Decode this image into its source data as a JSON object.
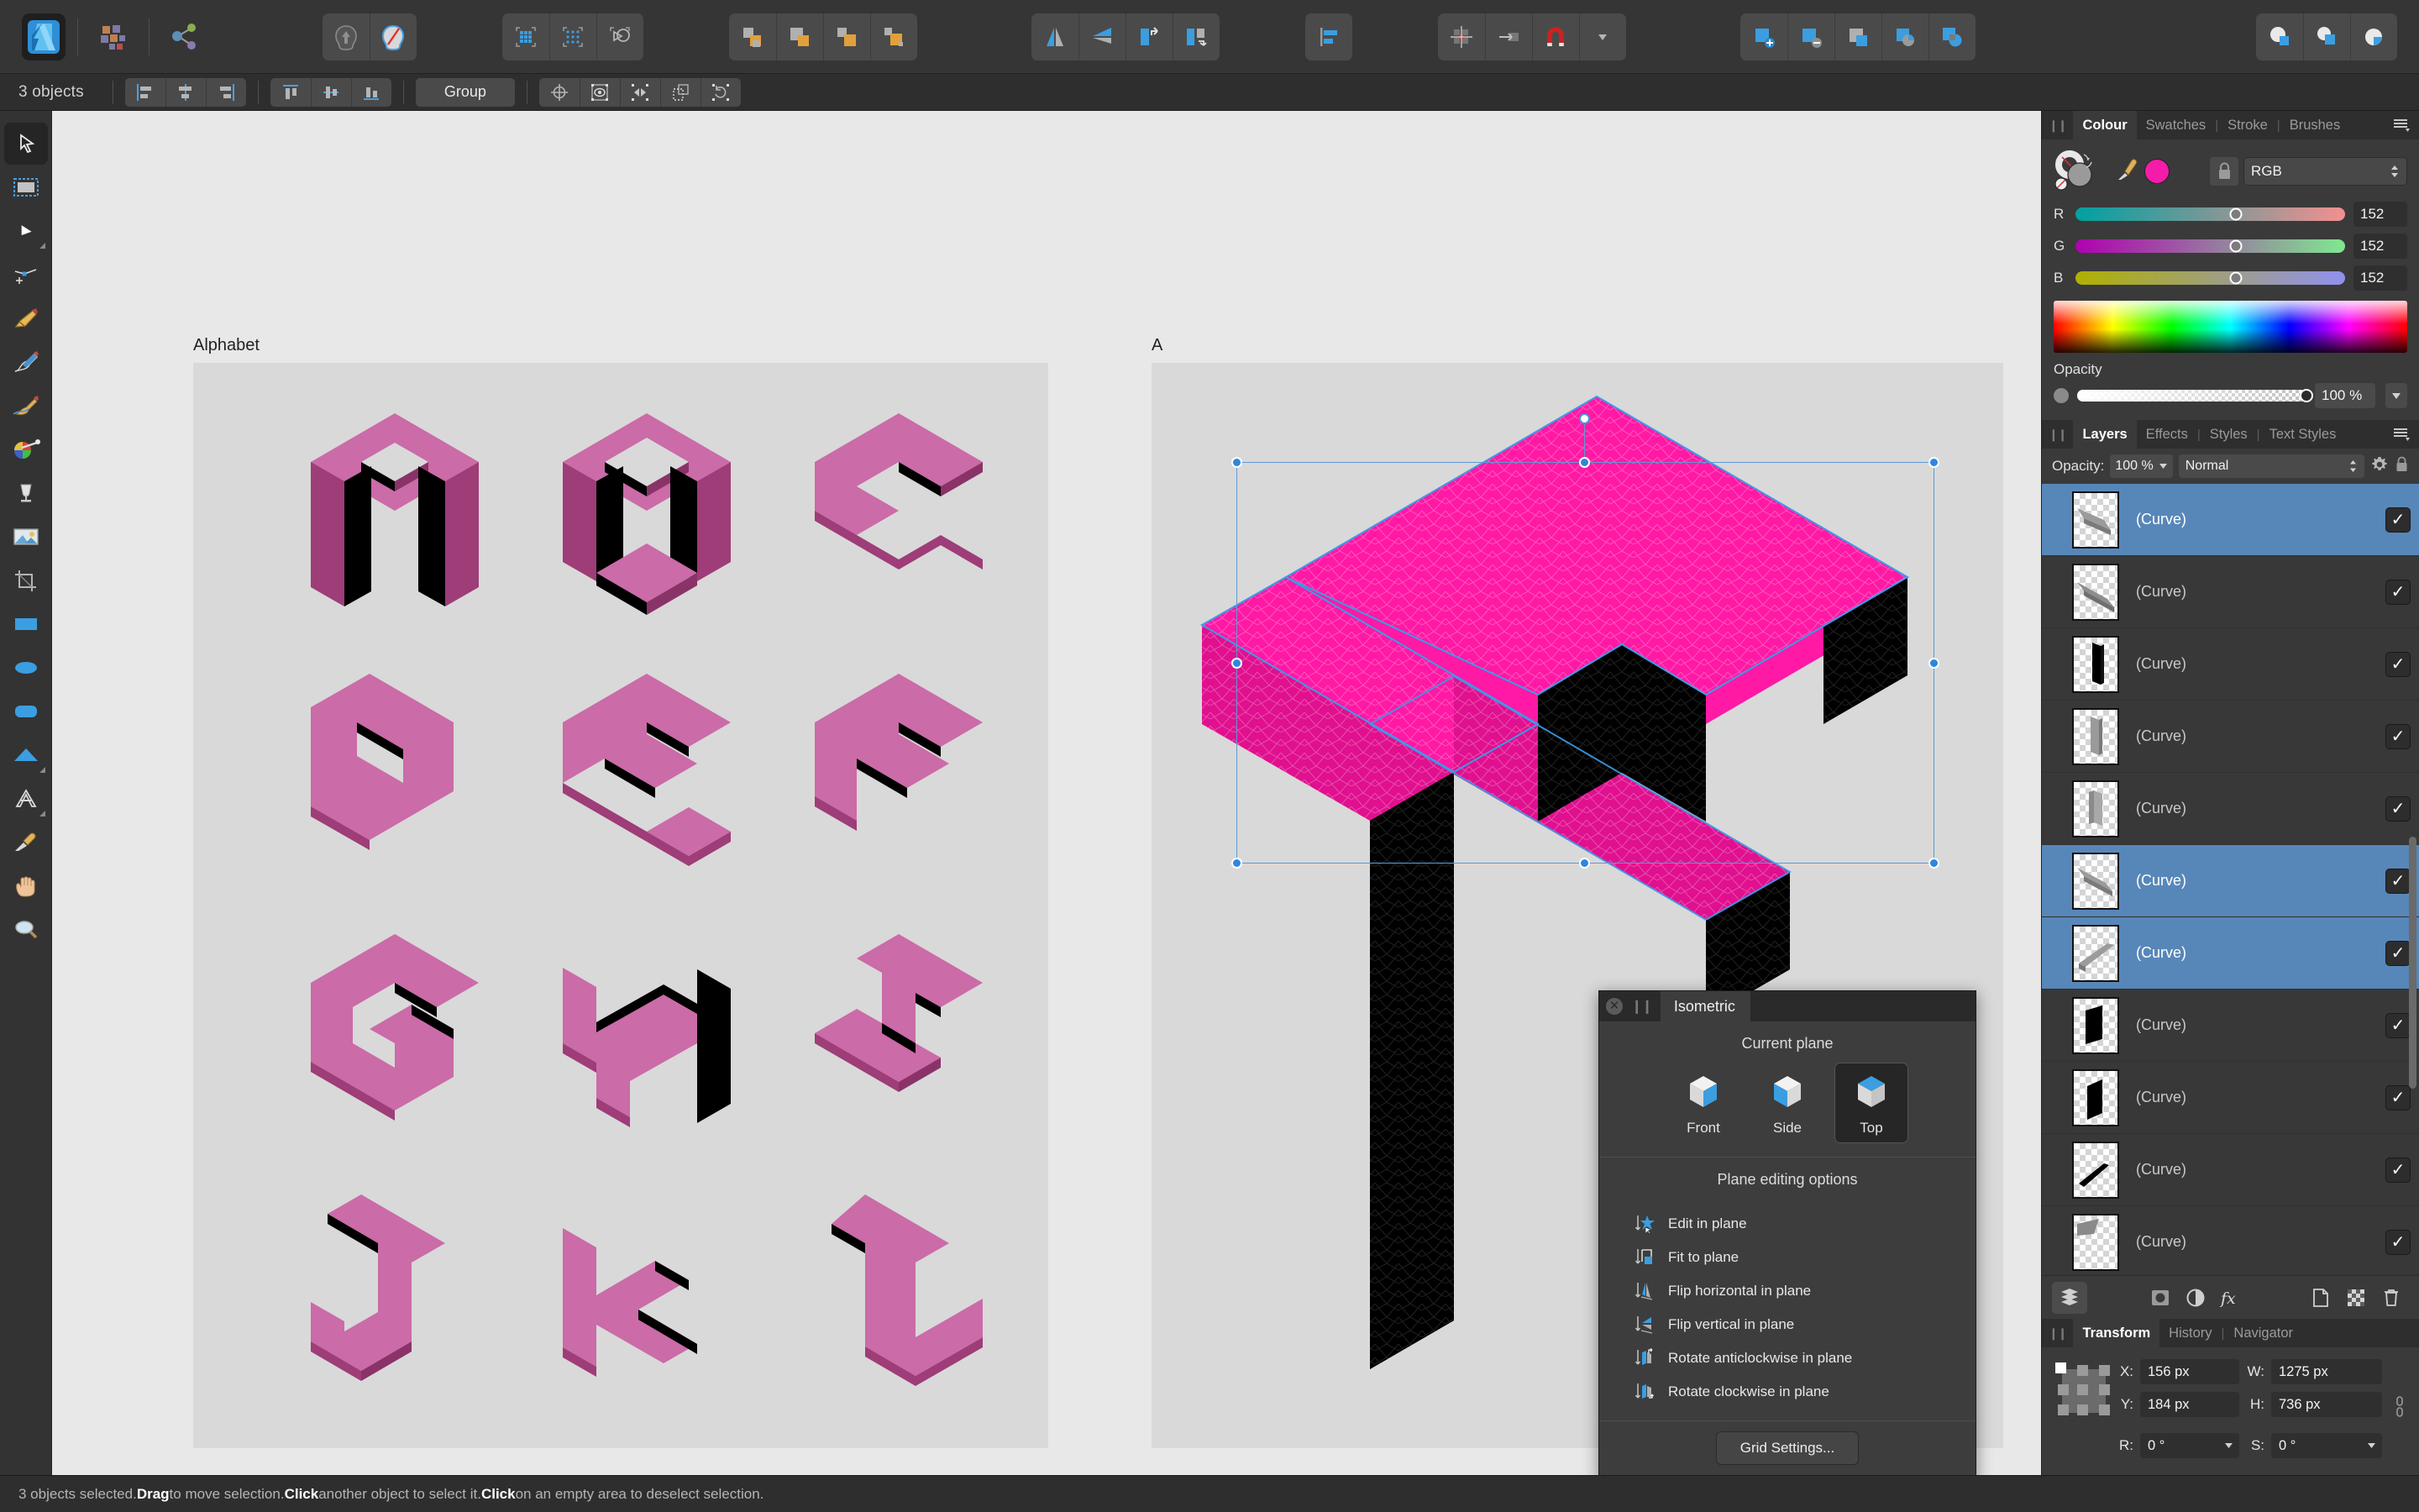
{
  "app": {
    "name": "Affinity Designer",
    "logo_icon": "affinity-designer-logo"
  },
  "toolbar": {
    "groups": [
      {
        "name": "assets",
        "buttons": [
          {
            "name": "assets-panel-button",
            "icon": "assets-grid-icon"
          },
          {
            "name": "share-button",
            "icon": "share-nodes-icon"
          }
        ]
      },
      {
        "name": "node-ops",
        "buttons": [
          {
            "name": "expand-stroke-button",
            "icon": "expand-stroke-icon"
          },
          {
            "name": "break-curve-button",
            "icon": "break-curve-icon"
          }
        ]
      },
      {
        "name": "grid-ops",
        "buttons": [
          {
            "name": "show-grid-button",
            "icon": "grid-icon"
          },
          {
            "name": "snap-to-grid-button",
            "icon": "dotted-grid-icon"
          },
          {
            "name": "geometry-button",
            "icon": "geometry-shapes-icon"
          }
        ]
      },
      {
        "name": "boolean-ops",
        "buttons": [
          {
            "name": "add-button",
            "icon": "boolean-add-icon"
          },
          {
            "name": "subtract-button",
            "icon": "boolean-subtract-icon"
          },
          {
            "name": "intersect-button",
            "icon": "boolean-intersect-icon"
          },
          {
            "name": "divide-button",
            "icon": "boolean-divide-icon"
          }
        ]
      },
      {
        "name": "flip-ops",
        "buttons": [
          {
            "name": "flip-horizontal-button",
            "icon": "flip-horizontal-icon"
          },
          {
            "name": "flip-vertical-button",
            "icon": "flip-vertical-icon"
          },
          {
            "name": "rotate-left-button",
            "icon": "rotate-left-icon"
          },
          {
            "name": "rotate-right-button",
            "icon": "rotate-right-icon"
          }
        ]
      },
      {
        "name": "align",
        "buttons": [
          {
            "name": "alignment-button",
            "icon": "align-left-icon"
          }
        ]
      },
      {
        "name": "snapping",
        "buttons": [
          {
            "name": "snapping-candidates-button",
            "icon": "snap-points-icon"
          },
          {
            "name": "snapping-move-button",
            "icon": "snap-move-icon",
            "active": true
          },
          {
            "name": "snapping-magnet-button",
            "icon": "magnet-icon",
            "has_dropdown": true
          }
        ]
      },
      {
        "name": "layer-ops",
        "buttons": [
          {
            "name": "add-layer-button",
            "icon": "layer-add-icon"
          },
          {
            "name": "remove-layer-button",
            "icon": "layer-remove-icon"
          },
          {
            "name": "mask-layer-button",
            "icon": "layer-mask-icon"
          },
          {
            "name": "clip-layer-button",
            "icon": "layer-clip-icon"
          },
          {
            "name": "merge-layer-button",
            "icon": "layer-merge-icon"
          }
        ]
      },
      {
        "name": "compound",
        "buttons": [
          {
            "name": "compound-add-button",
            "icon": "compound-add-icon"
          },
          {
            "name": "compound-subtract-button",
            "icon": "compound-subtract-icon"
          },
          {
            "name": "compound-xor-button",
            "icon": "compound-xor-icon"
          }
        ]
      }
    ]
  },
  "context_bar": {
    "selection_count": "3 objects",
    "align_h": [
      {
        "name": "align-left-button",
        "icon": "align-left-icon"
      },
      {
        "name": "align-center-horizontal-button",
        "icon": "align-center-h-icon"
      },
      {
        "name": "align-right-button",
        "icon": "align-right-icon"
      }
    ],
    "align_v": [
      {
        "name": "align-top-button",
        "icon": "align-top-icon"
      },
      {
        "name": "align-middle-button",
        "icon": "align-middle-icon"
      },
      {
        "name": "align-bottom-button",
        "icon": "align-bottom-icon"
      }
    ],
    "group_label": "Group",
    "extras": [
      {
        "name": "transform-origin-button",
        "icon": "crosshair-target-icon"
      },
      {
        "name": "show-handles-button",
        "icon": "eye-target-icon"
      },
      {
        "name": "mirror-button",
        "icon": "mirror-nodes-icon"
      },
      {
        "name": "duplicate-button",
        "icon": "duplicate-icon"
      },
      {
        "name": "reset-transform-button",
        "icon": "refresh-rotate-icon"
      }
    ]
  },
  "tools": [
    {
      "name": "move-tool",
      "icon": "arrow-cursor-icon",
      "active": true
    },
    {
      "name": "artboard-tool",
      "icon": "artboard-icon"
    },
    {
      "name": "node-tool",
      "icon": "node-cursor-icon",
      "flyout": true
    },
    {
      "name": "corner-tool",
      "icon": "corner-node-icon"
    },
    {
      "name": "pen-tool",
      "icon": "pen-nib-icon"
    },
    {
      "name": "pencil-tool",
      "icon": "pencil-icon"
    },
    {
      "name": "vector-brush-tool",
      "icon": "paint-brush-icon"
    },
    {
      "name": "fill-tool",
      "icon": "colour-wheel-icon"
    },
    {
      "name": "transparency-tool",
      "icon": "goblet-icon"
    },
    {
      "name": "place-image-tool",
      "icon": "image-icon"
    },
    {
      "name": "crop-tool",
      "icon": "crop-icon"
    },
    {
      "name": "rectangle-tool",
      "icon": "rectangle-icon"
    },
    {
      "name": "ellipse-tool",
      "icon": "ellipse-icon"
    },
    {
      "name": "rounded-rectangle-tool",
      "icon": "rounded-rect-icon"
    },
    {
      "name": "triangle-tool",
      "icon": "triangle-icon",
      "flyout": true
    },
    {
      "name": "artistic-text-tool",
      "icon": "text-a-icon",
      "flyout": true
    },
    {
      "name": "colour-picker-tool",
      "icon": "eyedropper-icon"
    },
    {
      "name": "view-tool",
      "icon": "hand-icon"
    },
    {
      "name": "zoom-tool",
      "icon": "magnifier-icon"
    }
  ],
  "canvas": {
    "artboards": [
      {
        "name": "artboard-alphabet",
        "label": "Alphabet"
      },
      {
        "name": "artboard-a",
        "label": "A"
      }
    ],
    "letters": [
      "A",
      "B",
      "C",
      "D",
      "E",
      "F",
      "G",
      "H",
      "I",
      "J",
      "K",
      "L"
    ],
    "colors": {
      "face_top": "#ff19a5",
      "face_left": "#e0108f",
      "face_right": "#000000",
      "small_top": "#cb6ba8",
      "small_left": "#9e3d78",
      "small_right": "#000000",
      "artboard_bg": "#d9d9d9",
      "canvas_bg": "#e8e8e8",
      "selection": "#2e86de"
    }
  },
  "isometric_panel": {
    "title": "Isometric",
    "close_icon": "close-icon",
    "current_plane_label": "Current plane",
    "planes": [
      {
        "name": "plane-front",
        "label": "Front",
        "active": false
      },
      {
        "name": "plane-side",
        "label": "Side",
        "active": false
      },
      {
        "name": "plane-top",
        "label": "Top",
        "active": true
      }
    ],
    "options_label": "Plane editing options",
    "options": [
      {
        "name": "edit-in-plane-option",
        "label": "Edit in plane",
        "icon": "edit-in-plane-icon"
      },
      {
        "name": "fit-to-plane-option",
        "label": "Fit to plane",
        "icon": "fit-to-plane-icon"
      },
      {
        "name": "flip-horizontal-in-plane-option",
        "label": "Flip horizontal in plane",
        "icon": "flip-horizontal-plane-icon"
      },
      {
        "name": "flip-vertical-in-plane-option",
        "label": "Flip vertical in plane",
        "icon": "flip-vertical-plane-icon"
      },
      {
        "name": "rotate-anticlockwise-in-plane-option",
        "label": "Rotate anticlockwise in plane",
        "icon": "rotate-anticlockwise-plane-icon"
      },
      {
        "name": "rotate-clockwise-in-plane-option",
        "label": "Rotate clockwise in plane",
        "icon": "rotate-clockwise-plane-icon"
      }
    ],
    "grid_settings_label": "Grid Settings..."
  },
  "colour_panel": {
    "tabs": [
      {
        "name": "tab-colour",
        "label": "Colour",
        "active": true
      },
      {
        "name": "tab-swatches",
        "label": "Swatches",
        "active": false
      },
      {
        "name": "tab-stroke",
        "label": "Stroke",
        "active": false
      },
      {
        "name": "tab-brushes",
        "label": "Brushes",
        "active": false
      }
    ],
    "menu_icon": "panel-menu-icon",
    "lock_icon": "lock-icon",
    "model": "RGB",
    "fill_swatch": "#f41ca8",
    "channels": [
      {
        "name": "channel-r",
        "label": "R",
        "value": "152",
        "pos": 59.6
      },
      {
        "name": "channel-g",
        "label": "G",
        "value": "152",
        "pos": 59.6
      },
      {
        "name": "channel-b",
        "label": "B",
        "value": "152",
        "pos": 59.6
      }
    ],
    "opacity_label": "Opacity",
    "opacity_value": "100 %"
  },
  "layers_panel": {
    "tabs": [
      {
        "name": "tab-layers",
        "label": "Layers",
        "active": true
      },
      {
        "name": "tab-effects",
        "label": "Effects",
        "active": false
      },
      {
        "name": "tab-styles",
        "label": "Styles",
        "active": false
      },
      {
        "name": "tab-text-styles",
        "label": "Text Styles",
        "active": false
      }
    ],
    "menu_icon": "panel-menu-icon",
    "opacity_label": "Opacity:",
    "opacity_value": "100 %",
    "blend_mode": "Normal",
    "gear_icon": "gear-icon",
    "lock_icon": "lock-icon",
    "rows": [
      {
        "name": "(Curve)",
        "selected": true,
        "checked": true,
        "thumb": "bar-grey-diag-down"
      },
      {
        "name": "(Curve)",
        "selected": false,
        "checked": true,
        "thumb": "bar-grey-diag-down2"
      },
      {
        "name": "(Curve)",
        "selected": false,
        "checked": true,
        "thumb": "slab-black-vertical"
      },
      {
        "name": "(Curve)",
        "selected": false,
        "checked": true,
        "thumb": "slab-grey-vertical"
      },
      {
        "name": "(Curve)",
        "selected": false,
        "checked": true,
        "thumb": "slab-grey-vertical2"
      },
      {
        "name": "(Curve)",
        "selected": true,
        "checked": true,
        "thumb": "bar-grey-diag-down3"
      },
      {
        "name": "(Curve)",
        "selected": true,
        "checked": true,
        "thumb": "bar-grey-diag-up"
      },
      {
        "name": "(Curve)",
        "selected": false,
        "checked": true,
        "thumb": "slab-black-vertical2"
      },
      {
        "name": "(Curve)",
        "selected": false,
        "checked": true,
        "thumb": "slab-black-vertical3"
      },
      {
        "name": "(Curve)",
        "selected": false,
        "checked": true,
        "thumb": "bar-black-diag"
      },
      {
        "name": "(Curve)",
        "selected": false,
        "checked": true,
        "thumb": "bar-grey-partial"
      }
    ],
    "footer": [
      {
        "name": "layers-stack-button",
        "icon": "layers-stack-icon",
        "active": true
      },
      {
        "name": "adjustment-button",
        "icon": "adjustment-circle-icon"
      },
      {
        "name": "live-filter-button",
        "icon": "half-circle-icon"
      },
      {
        "name": "effects-button",
        "icon": "fx-icon"
      },
      {
        "name": "add-layer-button",
        "icon": "new-page-icon"
      },
      {
        "name": "mask-button",
        "icon": "mask-checker-icon"
      },
      {
        "name": "delete-button",
        "icon": "trash-icon"
      }
    ]
  },
  "transform_panel": {
    "tabs": [
      {
        "name": "tab-transform",
        "label": "Transform",
        "active": true
      },
      {
        "name": "tab-history",
        "label": "History",
        "active": false
      },
      {
        "name": "tab-navigator",
        "label": "Navigator",
        "active": false
      }
    ],
    "fields": [
      {
        "name": "x-field",
        "label": "X:",
        "value": "156 px"
      },
      {
        "name": "w-field",
        "label": "W:",
        "value": "1275 px"
      },
      {
        "name": "y-field",
        "label": "Y:",
        "value": "184 px"
      },
      {
        "name": "h-field",
        "label": "H:",
        "value": "736 px"
      },
      {
        "name": "rotation-field",
        "label": "R:",
        "value": "0 °"
      },
      {
        "name": "shear-field",
        "label": "S:",
        "value": "0 °"
      }
    ],
    "link_icon": "chain-link-icon"
  },
  "statusbar": {
    "parts": [
      {
        "text": "3 objects selected. ",
        "bold": false
      },
      {
        "text": "Drag",
        "bold": true
      },
      {
        "text": " to move selection. ",
        "bold": false
      },
      {
        "text": "Click",
        "bold": true
      },
      {
        "text": " another object to select it. ",
        "bold": false
      },
      {
        "text": "Click",
        "bold": true
      },
      {
        "text": " on an empty area to deselect selection.",
        "bold": false
      }
    ]
  }
}
